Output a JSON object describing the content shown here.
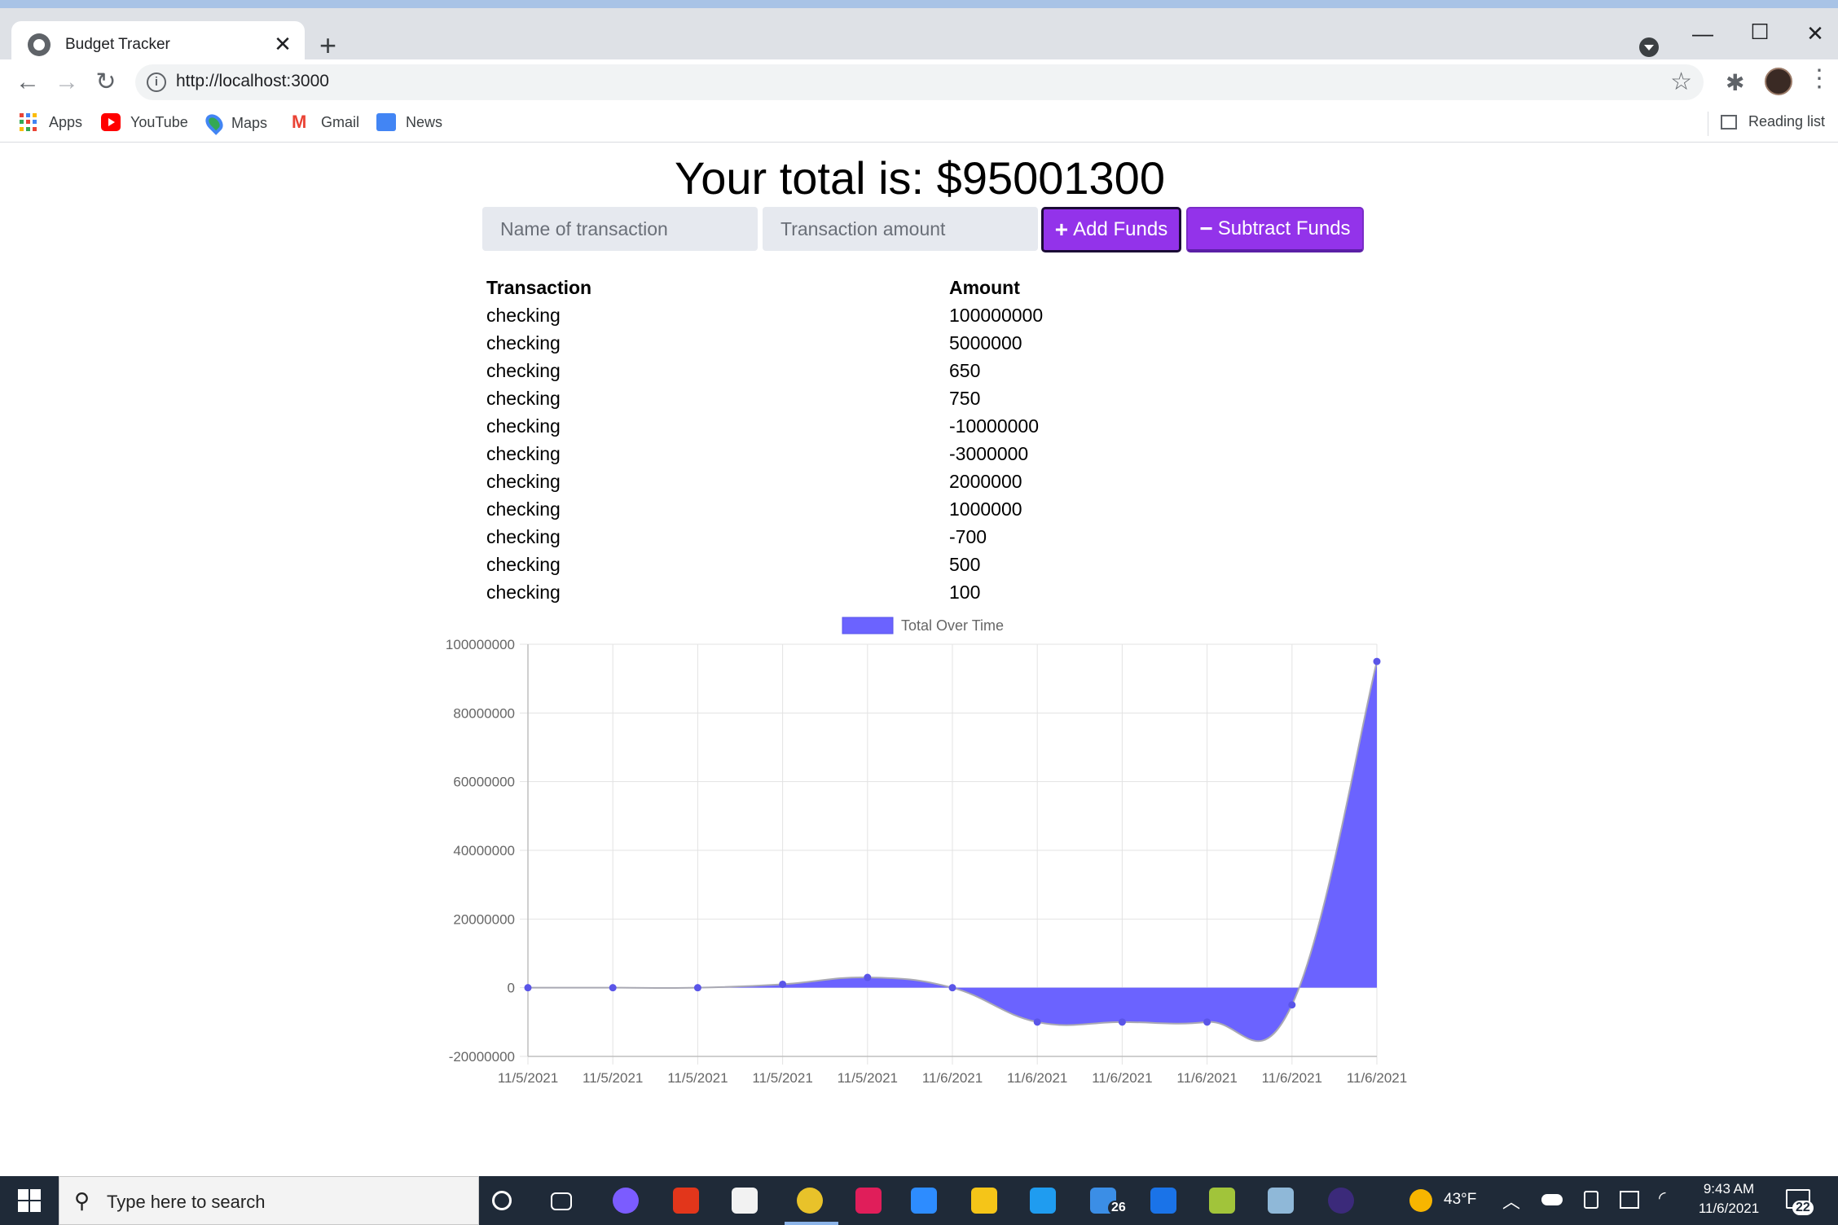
{
  "browser": {
    "tab_title": "Budget Tracker",
    "url": "http://localhost:3000",
    "bookmarks": [
      "Apps",
      "YouTube",
      "Maps",
      "Gmail",
      "News"
    ],
    "reading_list": "Reading list"
  },
  "page": {
    "total_text": "Your total is: $95001300",
    "name_placeholder": "Name of transaction",
    "amount_placeholder": "Transaction amount",
    "add_label": "Add Funds",
    "subtract_label": "Subtract Funds",
    "add_symbol": "+",
    "subtract_symbol": "−",
    "table_headers": [
      "Transaction",
      "Amount"
    ],
    "transactions": [
      {
        "name": "checking",
        "amount": "100000000"
      },
      {
        "name": "checking",
        "amount": "5000000"
      },
      {
        "name": "checking",
        "amount": "650"
      },
      {
        "name": "checking",
        "amount": "750"
      },
      {
        "name": "checking",
        "amount": "-10000000"
      },
      {
        "name": "checking",
        "amount": "-3000000"
      },
      {
        "name": "checking",
        "amount": "2000000"
      },
      {
        "name": "checking",
        "amount": "1000000"
      },
      {
        "name": "checking",
        "amount": "-700"
      },
      {
        "name": "checking",
        "amount": "500"
      },
      {
        "name": "checking",
        "amount": "100"
      }
    ]
  },
  "chart_data": {
    "type": "area",
    "title": "",
    "xlabel": "",
    "ylabel": "",
    "legend": "Total Over Time",
    "legend_position": "top",
    "grid": true,
    "categories": [
      "11/5/2021",
      "11/5/2021",
      "11/5/2021",
      "11/5/2021",
      "11/5/2021",
      "11/6/2021",
      "11/6/2021",
      "11/6/2021",
      "11/6/2021",
      "11/6/2021",
      "11/6/2021"
    ],
    "series": [
      {
        "name": "Total Over Time",
        "values": [
          100,
          600,
          100,
          1000000,
          3000000,
          0,
          -10000000,
          -10000000,
          -10000000,
          -5000000,
          95001300
        ]
      }
    ],
    "ylim": [
      -20000000,
      100000000
    ],
    "y_ticks": [
      "100000000",
      "80000000",
      "60000000",
      "40000000",
      "20000000",
      "0",
      "-20000000"
    ],
    "colors": {
      "fill": "#6b63ff",
      "line": "#a9a9b3",
      "point": "#5a55e8",
      "grid": "#e3e3e3"
    }
  },
  "taskbar": {
    "search_placeholder": "Type here to search",
    "weather": "43°F",
    "time": "9:43 AM",
    "date": "11/6/2021",
    "mail_badge": "26",
    "notification_badge": "22",
    "icons": [
      "cortana-icon",
      "task-view-icon",
      "messenger-icon",
      "office-icon",
      "store-icon",
      "chrome-icon",
      "slack-icon",
      "zoom-icon",
      "file-explorer-icon",
      "vscode-icon",
      "mail-icon",
      "calendar-icon",
      "git-icon",
      "notepad-icon",
      "eclipse-icon"
    ]
  }
}
